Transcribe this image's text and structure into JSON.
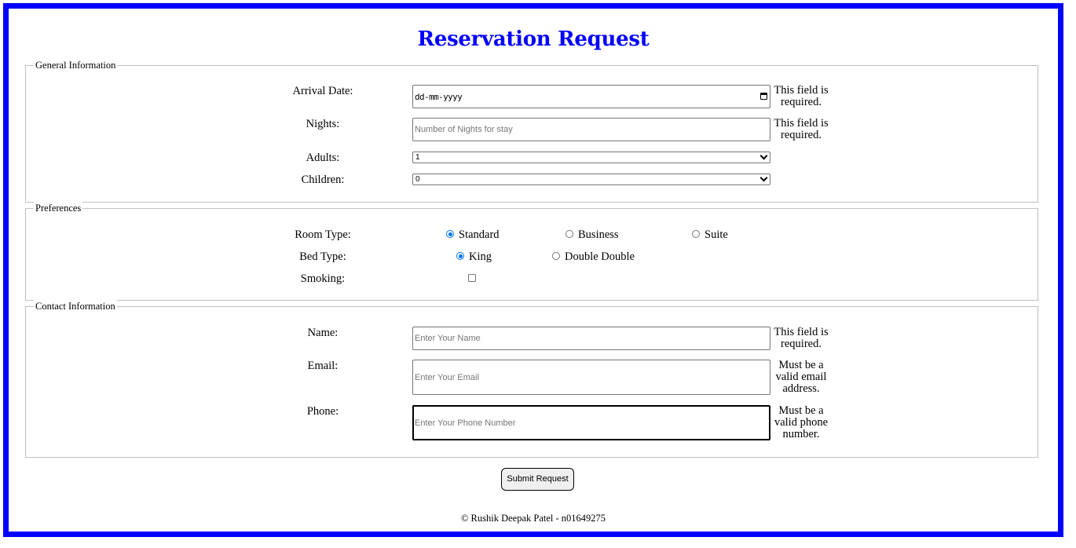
{
  "page": {
    "title": "Reservation Request",
    "footer": "© Rushik Deepak Patel - n01649275",
    "colors": {
      "frame": "#0000ff",
      "title": "#0000ff",
      "radio_accent": "#0075ff"
    }
  },
  "general": {
    "legend": "General Information",
    "arrival": {
      "label": "Arrival Date:",
      "value": "dd-mm-yyyy",
      "icon": "calendar-icon",
      "hint": "This field is required."
    },
    "nights": {
      "label": "Nights:",
      "placeholder": "Number of Nights for stay",
      "hint": "This field is required."
    },
    "adults": {
      "label": "Adults:",
      "selected": "1"
    },
    "children": {
      "label": "Children:",
      "selected": "0"
    }
  },
  "preferences": {
    "legend": "Preferences",
    "room_type": {
      "label": "Room Type:",
      "options": [
        "Standard",
        "Business",
        "Suite"
      ],
      "selected": "Standard"
    },
    "bed_type": {
      "label": "Bed Type:",
      "options": [
        "King",
        "Double Double"
      ],
      "selected": "King"
    },
    "smoking": {
      "label": "Smoking:",
      "checked": false
    }
  },
  "contact": {
    "legend": "Contact Information",
    "name": {
      "label": "Name:",
      "placeholder": "Enter Your Name",
      "hint": "This field is required."
    },
    "email": {
      "label": "Email:",
      "placeholder": "Enter Your Email",
      "hint": "Must be a valid email address."
    },
    "phone": {
      "label": "Phone:",
      "placeholder": "Enter Your Phone Number",
      "hint": "Must be a valid phone number."
    }
  },
  "submit": {
    "label": "Submit Request"
  }
}
